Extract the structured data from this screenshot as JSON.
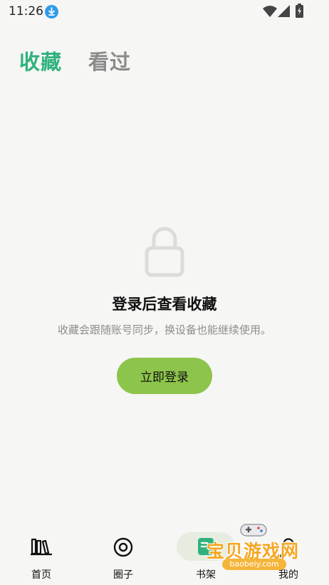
{
  "status_bar": {
    "time": "11:26"
  },
  "tabs": [
    {
      "label": "收藏",
      "active": true
    },
    {
      "label": "看过",
      "active": false
    }
  ],
  "empty_state": {
    "icon": "lock-icon",
    "title": "登录后查看收藏",
    "description": "收藏会跟随账号同步，换设备也能继续使用。",
    "button_label": "立即登录"
  },
  "bottom_nav": [
    {
      "label": "首页",
      "icon": "bookshelf-icon"
    },
    {
      "label": "圈子",
      "icon": "circle-icon"
    },
    {
      "label": "书架",
      "icon": "book-icon",
      "active": true
    },
    {
      "label": "我的",
      "icon": "user-icon"
    }
  ],
  "watermark": {
    "text": "宝贝游戏网",
    "url": "baobeiy.com"
  },
  "colors": {
    "accent_green": "#2fb27d",
    "button_green": "#8dc44b",
    "inactive_gray": "#8a8a8a",
    "background": "#f6f6f4"
  }
}
